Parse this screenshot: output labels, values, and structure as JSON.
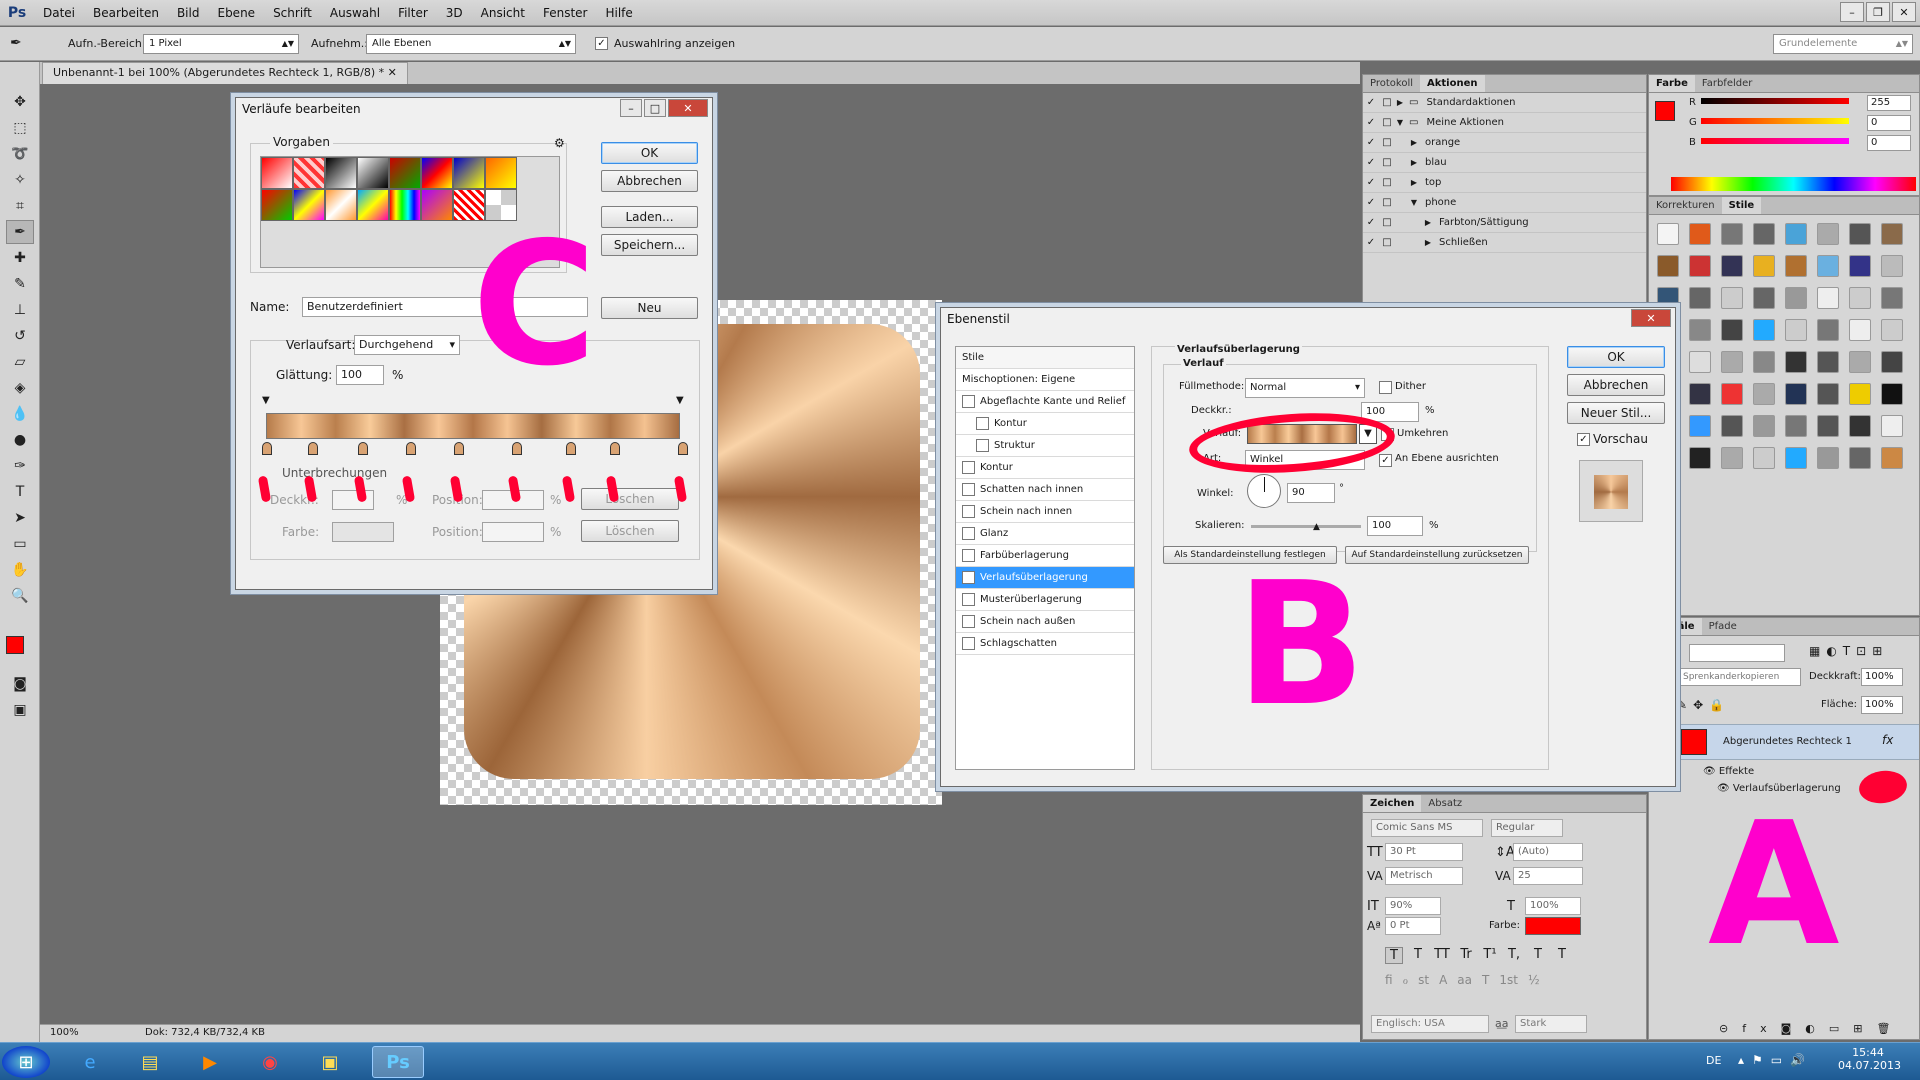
{
  "app": {
    "logo": "Ps"
  },
  "menu": [
    "Datei",
    "Bearbeiten",
    "Bild",
    "Ebene",
    "Schrift",
    "Auswahl",
    "Filter",
    "3D",
    "Ansicht",
    "Fenster",
    "Hilfe"
  ],
  "options": {
    "sample_size_label": "Aufn.-Bereich:",
    "sample_size_value": "1 Pixel",
    "sample_label": "Aufnehm.:",
    "sample_value": "Alle Ebenen",
    "show_ring_label": "Auswahlring anzeigen",
    "workspace": "Grundelemente"
  },
  "document": {
    "tab": "Unbenannt-1 bei 100% (Abgerundetes Rechteck 1, RGB/8) *"
  },
  "status": {
    "zoom": "100%",
    "doc": "Dok: 732,4 KB/732,4 KB"
  },
  "actions_panel": {
    "tabs": [
      "Protokoll",
      "Aktionen"
    ],
    "rows": [
      {
        "label": "Standardaktionen",
        "indent": 0,
        "expand": "▶"
      },
      {
        "label": "Meine Aktionen",
        "indent": 0,
        "expand": "▼"
      },
      {
        "label": "orange",
        "indent": 1,
        "expand": "▶"
      },
      {
        "label": "blau",
        "indent": 1,
        "expand": "▶"
      },
      {
        "label": "top",
        "indent": 1,
        "expand": "▶"
      },
      {
        "label": "phone",
        "indent": 1,
        "expand": "▼"
      },
      {
        "label": "Farbton/Sättigung",
        "indent": 2,
        "expand": "▶"
      },
      {
        "label": "Schließen",
        "indent": 2,
        "expand": "▶"
      }
    ]
  },
  "color_panel": {
    "tabs": [
      "Farbe",
      "Farbfelder"
    ],
    "channels": [
      {
        "label": "R",
        "value": "255"
      },
      {
        "label": "G",
        "value": "0"
      },
      {
        "label": "B",
        "value": "0"
      }
    ],
    "fg_color": "#ff0000"
  },
  "styles_panel": {
    "tabs": [
      "Korrekturen",
      "Stile"
    ]
  },
  "layers_panel": {
    "tabs": [
      "Kanäle",
      "Pfade"
    ],
    "blend": "Sprenkanderkopieren",
    "opacity_label": "Deckkraft:",
    "opacity": "100%",
    "fill_label": "Fläche:",
    "fill": "100%",
    "layer_name": "Abgerundetes Rechteck 1",
    "fx": "fx",
    "effects_label": "Effekte",
    "effect_item": "Verlaufsüberlagerung"
  },
  "char_panel": {
    "tabs": [
      "Zeichen",
      "Absatz"
    ],
    "font": "Comic Sans MS",
    "style": "Regular",
    "size": "30 Pt",
    "leading": "(Auto)",
    "kerning": "Metrisch",
    "tracking": "25",
    "vscale": "90%",
    "hscale": "100%",
    "baseline": "0 Pt",
    "color_label": "Farbe:",
    "color": "#ff0000",
    "type_styles": [
      "T",
      "T",
      "TT",
      "Tr",
      "T¹",
      "T,",
      "T",
      "T"
    ],
    "ot_features": [
      "fi",
      "ℴ",
      "st",
      "A",
      "aa",
      "T",
      "1st",
      "½"
    ],
    "language": "Englisch: USA",
    "aa_label": "a͟a",
    "antialias": "Stark"
  },
  "gradient_editor": {
    "title": "Verläufe bearbeiten",
    "presets_label": "Vorgaben",
    "ok": "OK",
    "cancel": "Abbrechen",
    "load": "Laden...",
    "save": "Speichern...",
    "name_label": "Name:",
    "name_value": "Benutzerdefiniert",
    "new": "Neu",
    "type_label": "Verlaufsart:",
    "type_value": "Durchgehend",
    "smooth_label": "Glättung:",
    "smooth_value": "100",
    "pct": "%",
    "stops_label": "Unterbrechungen",
    "opacity_label": "Deckkr.:",
    "position_label": "Position:",
    "delete": "Löschen",
    "color_label": "Farbe:",
    "presets": [
      "linear-gradient(135deg,#ff0000,#fff)",
      "repeating-linear-gradient(45deg,#f33 0 4px,#fcc 4px 8px)",
      "linear-gradient(135deg,#000,#fff)",
      "linear-gradient(135deg,#fff,#000)",
      "linear-gradient(135deg,#c00,#0a0)",
      "linear-gradient(135deg,#00f,#f00,#ff0)",
      "linear-gradient(135deg,#00c,#ff0)",
      "linear-gradient(135deg,#f60,#ff0)",
      "linear-gradient(135deg,#f00,#0c0)",
      "linear-gradient(135deg,#00f,#ff0,#f0f)",
      "linear-gradient(135deg,#f93,#fff,#f93)",
      "linear-gradient(135deg,#0af,#ff0,#f0a)",
      "linear-gradient(90deg,#f00,#ff0,#0f0,#0ff,#00f,#f0f)",
      "linear-gradient(135deg,#a0f,#f80)",
      "repeating-linear-gradient(45deg,#f00 0 3px,#fff 3px 6px)",
      "repeating-conic-gradient(#ccc 0 25%,#fff 0 50%)"
    ]
  },
  "layer_style": {
    "title": "Ebenenstil",
    "styles_header": "Stile",
    "blend_header": "Mischoptionen: Eigene",
    "items": [
      {
        "label": "Abgeflachte Kante und Relief",
        "checked": false,
        "sub": false
      },
      {
        "label": "Kontur",
        "checked": false,
        "sub": true
      },
      {
        "label": "Struktur",
        "checked": false,
        "sub": true
      },
      {
        "label": "Kontur",
        "checked": false,
        "sub": false
      },
      {
        "label": "Schatten nach innen",
        "checked": false,
        "sub": false
      },
      {
        "label": "Schein nach innen",
        "checked": false,
        "sub": false
      },
      {
        "label": "Glanz",
        "checked": false,
        "sub": false
      },
      {
        "label": "Farbüberlagerung",
        "checked": false,
        "sub": false
      },
      {
        "label": "Verlaufsüberlagerung",
        "checked": true,
        "sub": false,
        "selected": true
      },
      {
        "label": "Musterüberlagerung",
        "checked": false,
        "sub": false
      },
      {
        "label": "Schein nach außen",
        "checked": false,
        "sub": false
      },
      {
        "label": "Schlagschatten",
        "checked": false,
        "sub": false
      }
    ],
    "section_title": "Verlaufsüberlagerung",
    "subsection": "Verlauf",
    "blend_label": "Füllmethode:",
    "blend_value": "Normal",
    "dither": "Dither",
    "opacity_label": "Deckkr.:",
    "opacity_value": "100",
    "gradient_label": "Verlauf:",
    "reverse": "Umkehren",
    "style_label": "Art:",
    "style_value": "Winkel",
    "align": "An Ebene ausrichten",
    "angle_label": "Winkel:",
    "angle_value": "90",
    "degree": "°",
    "scale_label": "Skalieren:",
    "scale_value": "100",
    "pct": "%",
    "set_default": "Als Standardeinstellung festlegen",
    "reset_default": "Auf Standardeinstellung zurücksetzen",
    "ok": "OK",
    "cancel": "Abbrechen",
    "new_style": "Neuer Stil...",
    "preview": "Vorschau"
  },
  "annotations": {
    "a": "A",
    "b": "B",
    "c": "C"
  },
  "taskbar": {
    "lang": "DE",
    "time": "15:44",
    "date": "04.07.2013"
  }
}
